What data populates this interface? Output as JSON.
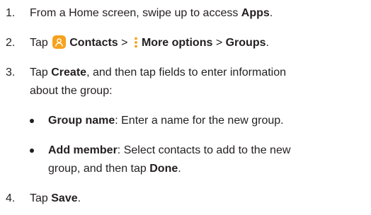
{
  "steps": [
    {
      "number": "1.",
      "pre": "From a Home screen, swipe up to access ",
      "apps": "Apps",
      "post": "."
    },
    {
      "number": "2.",
      "tap": "Tap ",
      "contacts": "Contacts",
      "sep1": " > ",
      "more_options": "More options",
      "sep2": " > ",
      "groups": "Groups",
      "post": "."
    },
    {
      "number": "3.",
      "tap": "Tap ",
      "create": "Create",
      "line1_rest": ", and then tap fields to enter information",
      "line2": "about the group:"
    },
    {
      "number": "4.",
      "tap": "Tap ",
      "save": "Save",
      "post": "."
    }
  ],
  "bullets": [
    {
      "label": "Group name",
      "text": ": Enter a name for the new group."
    },
    {
      "label": "Add member",
      "text1": ": Select contacts to add to the new",
      "text2_pre": "group, and then tap ",
      "done": "Done",
      "text2_post": "."
    }
  ],
  "colors": {
    "text": "#231f20",
    "contacts_icon": "#f6a21d"
  },
  "icons": {
    "contacts": "contacts-app-icon",
    "more_options": "vertical-ellipsis-icon"
  }
}
